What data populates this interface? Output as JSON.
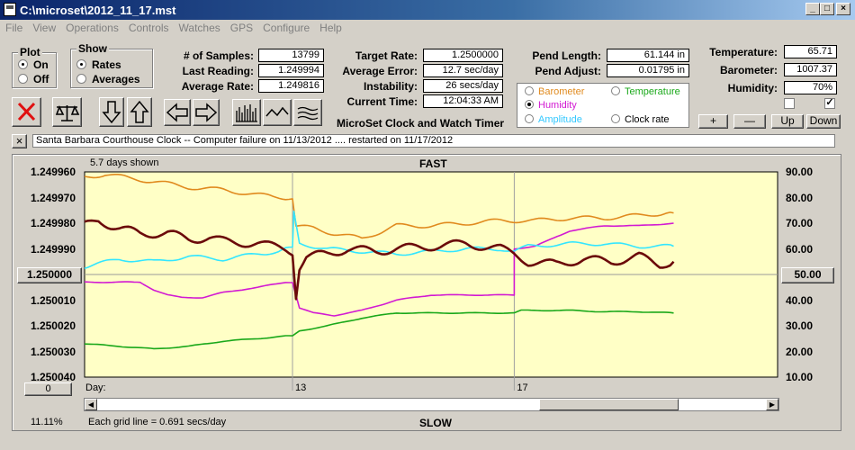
{
  "window": {
    "title": "C:\\microset\\2012_11_17.mst"
  },
  "menu": [
    "File",
    "View",
    "Operations",
    "Controls",
    "Watches",
    "GPS",
    "Configure",
    "Help"
  ],
  "plot_group": {
    "title": "Plot",
    "on": "On",
    "off": "Off",
    "selected": "On"
  },
  "show_group": {
    "title": "Show",
    "rates": "Rates",
    "averages": "Averages",
    "selected": "Rates"
  },
  "stats": {
    "samples_label": "# of Samples:",
    "samples": "13799",
    "last_reading_label": "Last Reading:",
    "last_reading": "1.249994",
    "average_rate_label": "Average Rate:",
    "average_rate": "1.249816",
    "target_rate_label": "Target Rate:",
    "target_rate": "1.2500000",
    "average_error_label": "Average Error:",
    "average_error": "12.7 sec/day",
    "instability_label": "Instability:",
    "instability": "26 secs/day",
    "current_time_label": "Current Time:",
    "current_time": "12:04:33 AM",
    "pend_length_label": "Pend Length:",
    "pend_length": "61.144 in",
    "pend_adjust_label": "Pend Adjust:",
    "pend_adjust": "0.01795 in",
    "temperature_label": "Temperature:",
    "temperature": "65.71",
    "barometer_label": "Barometer:",
    "barometer": "1007.37",
    "humidity_label": "Humidity:",
    "humidity": "70%"
  },
  "series_selector": {
    "barometer": "Barometer",
    "temperature": "Temperature",
    "humidity": "Humidity",
    "amplitude": "Amplitude",
    "clock_rate": "Clock rate",
    "selected": "Humidity"
  },
  "series_colors": {
    "rate": "#6b0a0a",
    "barometer": "#e08a1e",
    "temperature": "#1aa81a",
    "humidity": "#d21ad2",
    "amplitude": "#33e6ff",
    "background": "#ffffc6"
  },
  "heading": "MicroSet Clock and Watch Timer",
  "small_buttons": {
    "plus": "+",
    "minus": "—",
    "up": "Up",
    "down": "Down"
  },
  "toolbar_icons": [
    "close-x-icon",
    "balance-scale-icon",
    "arrow-down-icon",
    "arrow-up-icon",
    "arrow-left-icon",
    "arrow-right-icon",
    "histogram-icon",
    "waveform-icon",
    "wave-lines-icon"
  ],
  "info_close": "×",
  "info_text": "Santa Barbara Courthouse Clock   --  Computer failure on 11/13/2012  ....  restarted on 11/17/2012",
  "chart": {
    "days_shown": "5.7 days shown",
    "top_label": "FAST",
    "bottom_label": "SLOW",
    "left_center_button": "1.250000",
    "right_center_button": "50.00",
    "bottom_left_button": "0",
    "day_label": "Day:",
    "grid_note": "Each grid line = 0.691 secs/day",
    "percent": "11.11%"
  },
  "chart_data": {
    "type": "line",
    "left_axis_ticks": [
      "1.249960",
      "1.249970",
      "1.249980",
      "1.249990",
      "1.250000",
      "1.250010",
      "1.250020",
      "1.250030",
      "1.250040"
    ],
    "right_axis_ticks": [
      "90.00",
      "80.00",
      "70.00",
      "60.00",
      "50.00",
      "40.00",
      "30.00",
      "20.00",
      "10.00"
    ],
    "x_ticks": [
      {
        "label": "13",
        "x": 0.3
      },
      {
        "label": "17",
        "x": 0.62
      }
    ],
    "x_range": [
      0,
      1
    ],
    "right_range": [
      10,
      90
    ],
    "series": [
      {
        "key": "barometer",
        "points": [
          [
            0,
            88
          ],
          [
            0.03,
            89
          ],
          [
            0.08,
            87
          ],
          [
            0.13,
            85
          ],
          [
            0.15,
            84
          ],
          [
            0.2,
            83
          ],
          [
            0.25,
            81
          ],
          [
            0.29,
            80
          ],
          [
            0.3,
            80
          ],
          [
            0.305,
            69
          ],
          [
            0.33,
            68
          ],
          [
            0.36,
            66
          ],
          [
            0.4,
            64
          ],
          [
            0.42,
            66
          ],
          [
            0.45,
            69
          ],
          [
            0.5,
            69
          ],
          [
            0.55,
            70
          ],
          [
            0.6,
            71
          ],
          [
            0.65,
            71
          ],
          [
            0.7,
            72
          ],
          [
            0.75,
            72
          ],
          [
            0.8,
            73
          ],
          [
            0.84,
            74
          ],
          [
            0.85,
            74
          ]
        ]
      },
      {
        "key": "temperature",
        "points": [
          [
            0,
            23
          ],
          [
            0.05,
            22
          ],
          [
            0.1,
            21
          ],
          [
            0.15,
            22
          ],
          [
            0.2,
            24
          ],
          [
            0.25,
            25
          ],
          [
            0.29,
            26
          ],
          [
            0.3,
            26
          ],
          [
            0.31,
            28
          ],
          [
            0.35,
            30
          ],
          [
            0.4,
            33
          ],
          [
            0.45,
            35
          ],
          [
            0.5,
            35
          ],
          [
            0.55,
            35
          ],
          [
            0.6,
            35
          ],
          [
            0.62,
            35
          ],
          [
            0.63,
            36
          ],
          [
            0.7,
            36
          ],
          [
            0.75,
            35.5
          ],
          [
            0.8,
            35.5
          ],
          [
            0.85,
            35
          ]
        ]
      },
      {
        "key": "humidity",
        "points": [
          [
            0,
            47
          ],
          [
            0.08,
            47
          ],
          [
            0.1,
            44
          ],
          [
            0.12,
            42
          ],
          [
            0.14,
            41
          ],
          [
            0.17,
            41
          ],
          [
            0.2,
            43
          ],
          [
            0.25,
            45
          ],
          [
            0.29,
            47
          ],
          [
            0.3,
            47
          ],
          [
            0.31,
            37
          ],
          [
            0.33,
            35
          ],
          [
            0.36,
            34
          ],
          [
            0.4,
            36
          ],
          [
            0.45,
            40
          ],
          [
            0.5,
            42
          ],
          [
            0.55,
            42
          ],
          [
            0.61,
            42
          ],
          [
            0.62,
            42
          ],
          [
            0.62,
            60
          ],
          [
            0.65,
            61
          ],
          [
            0.7,
            67
          ],
          [
            0.75,
            69
          ],
          [
            0.8,
            69
          ],
          [
            0.85,
            70
          ]
        ]
      },
      {
        "key": "amplitude",
        "points": [
          [
            0,
            53
          ],
          [
            0.05,
            56
          ],
          [
            0.1,
            55
          ],
          [
            0.15,
            57
          ],
          [
            0.2,
            56
          ],
          [
            0.25,
            58
          ],
          [
            0.28,
            59
          ],
          [
            0.29,
            60
          ],
          [
            0.3,
            60
          ],
          [
            0.302,
            74
          ],
          [
            0.31,
            62
          ],
          [
            0.35,
            60
          ],
          [
            0.4,
            59
          ],
          [
            0.45,
            58
          ],
          [
            0.5,
            59
          ],
          [
            0.55,
            60
          ],
          [
            0.6,
            60
          ],
          [
            0.62,
            59
          ],
          [
            0.64,
            61
          ],
          [
            0.7,
            62
          ],
          [
            0.75,
            62
          ],
          [
            0.8,
            61
          ],
          [
            0.85,
            61
          ]
        ]
      },
      {
        "key": "rate",
        "points": [
          [
            0,
            69
          ],
          [
            0.02,
            71
          ],
          [
            0.05,
            68
          ],
          [
            0.08,
            66
          ],
          [
            0.12,
            66
          ],
          [
            0.15,
            64
          ],
          [
            0.18,
            64
          ],
          [
            0.2,
            63
          ],
          [
            0.25,
            62
          ],
          [
            0.27,
            61
          ],
          [
            0.29,
            60
          ],
          [
            0.3,
            59
          ],
          [
            0.305,
            42
          ],
          [
            0.31,
            53
          ],
          [
            0.32,
            57
          ],
          [
            0.35,
            58
          ],
          [
            0.38,
            60
          ],
          [
            0.42,
            59
          ],
          [
            0.45,
            60
          ],
          [
            0.5,
            61
          ],
          [
            0.55,
            62
          ],
          [
            0.6,
            60
          ],
          [
            0.62,
            58
          ],
          [
            0.64,
            55
          ],
          [
            0.68,
            54
          ],
          [
            0.72,
            56
          ],
          [
            0.76,
            55
          ],
          [
            0.8,
            57
          ],
          [
            0.83,
            54
          ],
          [
            0.85,
            55
          ]
        ]
      }
    ]
  }
}
